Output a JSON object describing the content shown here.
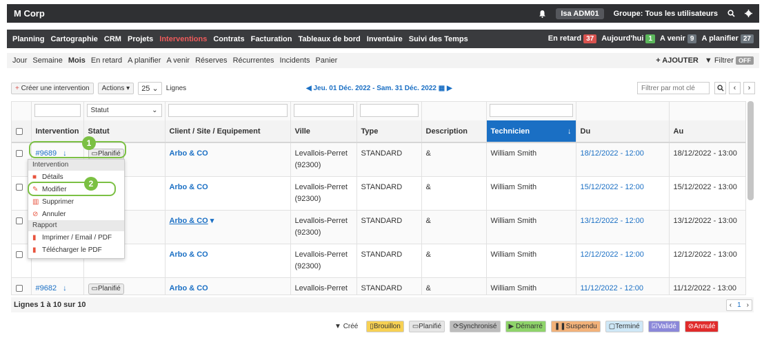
{
  "topbar": {
    "brand": "M Corp",
    "user": "Isa ADM01",
    "group": "Groupe: Tous les utilisateurs",
    "icons": [
      "bell-icon",
      "search-icon",
      "gear-icon"
    ]
  },
  "nav": {
    "items": [
      "Planning",
      "Cartographie",
      "CRM",
      "Projets",
      "Interventions",
      "Contrats",
      "Facturation",
      "Tableaux de bord",
      "Inventaire",
      "Suivi des Temps"
    ],
    "active": "Interventions",
    "counters": [
      {
        "label": "En retard",
        "count": "37",
        "color": "#d9534f"
      },
      {
        "label": "Aujourd'hui",
        "count": "1",
        "color": "#5cb85c"
      },
      {
        "label": "A venir",
        "count": "9",
        "color": "#6c757d"
      },
      {
        "label": "A planifier",
        "count": "27",
        "color": "#6c757d"
      }
    ]
  },
  "subnav": {
    "items": [
      "Jour",
      "Semaine",
      "Mois",
      "En retard",
      "A planifier",
      "A venir",
      "Réserves",
      "Récurrentes",
      "Incidents",
      "Panier"
    ],
    "active": "Mois",
    "add_label": "+ AJOUTER",
    "filter_label": "Filtrer",
    "filter_state": "OFF"
  },
  "toolbar": {
    "create_label": "Créer une intervention",
    "actions_label": "Actions",
    "page_size": "25",
    "page_size_suffix": "Lignes",
    "date_range": "Jeu. 01 Déc. 2022 - Sam. 31 Déc. 2022",
    "search_placeholder": "Filtrer par mot clé"
  },
  "filters": {
    "statut_label": "Statut"
  },
  "table": {
    "columns": [
      "Intervention",
      "Statut",
      "Client / Site / Equipement",
      "Ville",
      "Type",
      "Description",
      "Technicien",
      "Du",
      "Au"
    ],
    "rows": [
      {
        "id": "#9689",
        "status": "Planifié",
        "client": "Arbo & CO",
        "city": "Levallois-Perret",
        "zip": "(92300)",
        "type": "STANDARD",
        "desc": "&",
        "tech": "William Smith",
        "du": "18/12/2022 - 12:00",
        "au": "18/12/2022 - 13:00"
      },
      {
        "id": "",
        "status": "",
        "client": "Arbo & CO",
        "city": "Levallois-Perret",
        "zip": "(92300)",
        "type": "STANDARD",
        "desc": "&",
        "tech": "William Smith",
        "du": "15/12/2022 - 12:00",
        "au": "15/12/2022 - 13:00"
      },
      {
        "id": "",
        "status": "",
        "client": "Arbo & CO",
        "city": "Levallois-Perret",
        "zip": "(92300)",
        "type": "STANDARD",
        "desc": "&",
        "tech": "William Smith",
        "du": "13/12/2022 - 12:00",
        "au": "13/12/2022 - 13:00"
      },
      {
        "id": "",
        "status": "",
        "client": "Arbo & CO",
        "city": "Levallois-Perret",
        "zip": "(92300)",
        "type": "STANDARD",
        "desc": "&",
        "tech": "William Smith",
        "du": "12/12/2022 - 12:00",
        "au": "12/12/2022 - 13:00"
      },
      {
        "id": "#9682",
        "status": "Planifié",
        "client": "Arbo & CO",
        "city": "Levallois-Perret",
        "zip": "",
        "type": "STANDARD",
        "desc": "&",
        "tech": "William Smith",
        "du": "11/12/2022 - 12:00",
        "au": "11/12/2022 - 13:00"
      }
    ]
  },
  "menu": {
    "section1": "Intervention",
    "details": "Détails",
    "modify": "Modifier",
    "delete": "Supprimer",
    "cancel": "Annuler",
    "section2": "Rapport",
    "print": "Imprimer / Email / PDF",
    "download": "Télécharger le PDF"
  },
  "callouts": [
    "1",
    "2"
  ],
  "footer": {
    "lines": "Lignes 1 à 10 sur 10",
    "page": "1"
  },
  "legend": [
    {
      "label": "Créé",
      "bg": "#ffffff",
      "fg": "#333333"
    },
    {
      "label": "Brouillon",
      "bg": "#f7d154",
      "fg": "#333333"
    },
    {
      "label": "Planifié",
      "bg": "#e6e6e6",
      "fg": "#333333"
    },
    {
      "label": "Synchronisé",
      "bg": "#bdbdbd",
      "fg": "#333333"
    },
    {
      "label": "Démarré",
      "bg": "#8fd46b",
      "fg": "#333333"
    },
    {
      "label": "Suspendu",
      "bg": "#f2b27a",
      "fg": "#333333"
    },
    {
      "label": "Terminé",
      "bg": "#cfe8f7",
      "fg": "#333333"
    },
    {
      "label": "Validé",
      "bg": "#8b88d9",
      "fg": "#ffffff"
    },
    {
      "label": "Annulé",
      "bg": "#e02b2b",
      "fg": "#ffffff"
    }
  ]
}
